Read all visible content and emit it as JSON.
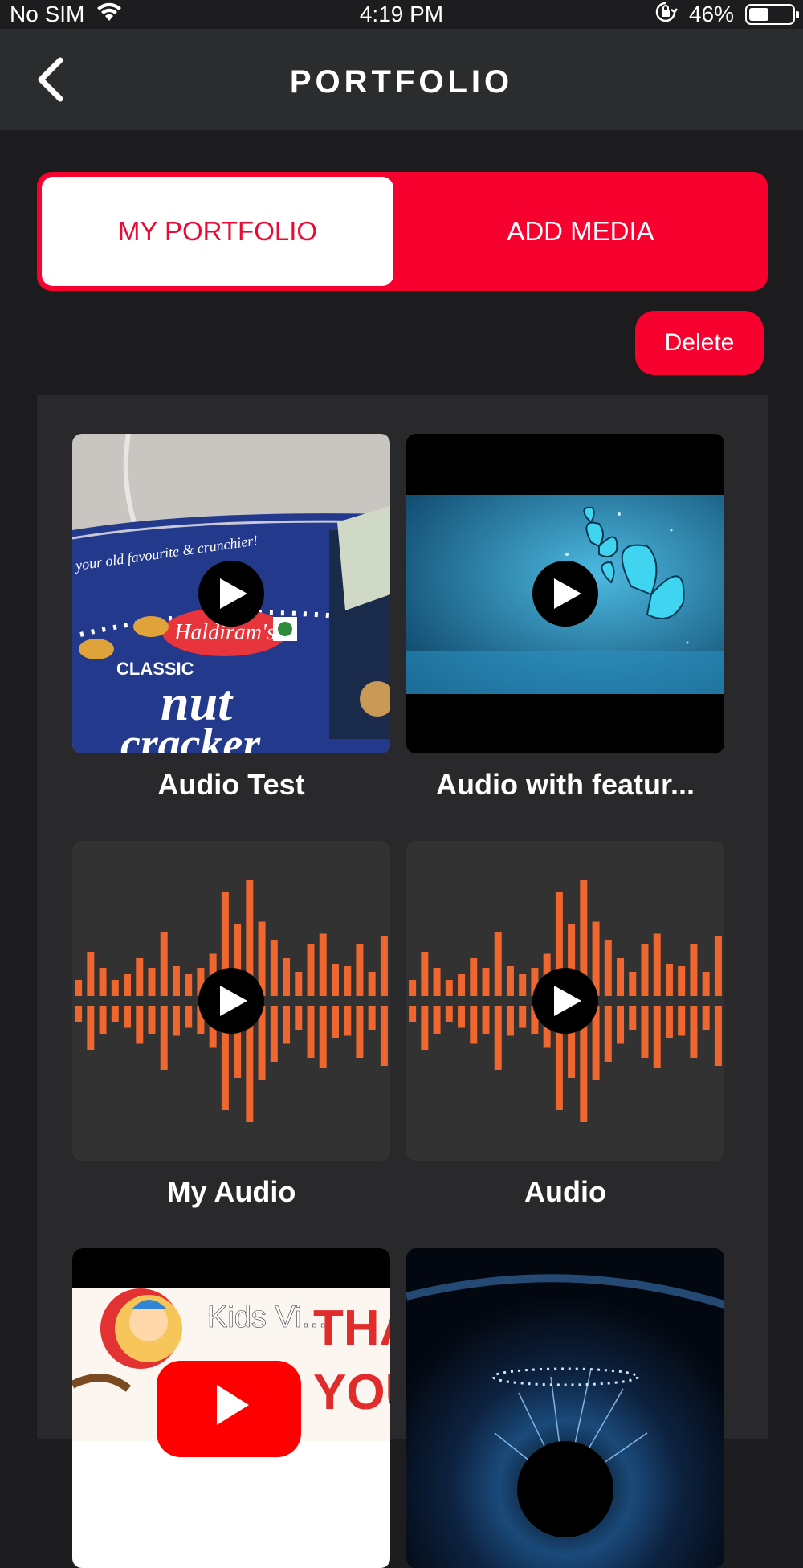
{
  "status_bar": {
    "carrier": "No SIM",
    "time": "4:19 PM",
    "battery_percent": "46%",
    "battery_level": 0.46
  },
  "header": {
    "title": "PORTFOLIO"
  },
  "tabs": {
    "active_label": "MY PORTFOLIO",
    "inactive_label": "ADD MEDIA"
  },
  "actions": {
    "delete_label": "Delete"
  },
  "media": [
    {
      "title": "Audio Test",
      "thumbnail": "snack-package-photo",
      "thumb_text": [
        "your old favourite & crunchier!",
        "Haldiram's",
        "CLASSIC",
        "nut",
        "cracker"
      ]
    },
    {
      "title": "Audio with featur...",
      "thumbnail": "blue-butterflies-image"
    },
    {
      "title": "My Audio",
      "thumbnail": "orange-waveform"
    },
    {
      "title": "Audio",
      "thumbnail": "orange-waveform"
    },
    {
      "title": "",
      "thumbnail": "kids-video-youtube-thumbnail",
      "thumb_text": [
        "Kids Vi...",
        "THANK",
        "YOU"
      ]
    },
    {
      "title": "",
      "thumbnail": "blue-eye-image"
    }
  ],
  "colors": {
    "accent": "#f7022f",
    "waveform": "#f0662f",
    "background": "#1c1c1e",
    "panel": "#29292c"
  }
}
